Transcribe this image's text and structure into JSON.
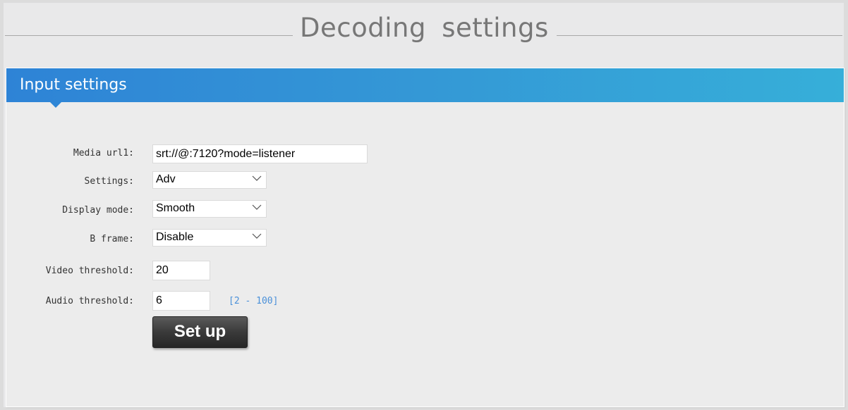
{
  "page": {
    "title": "Decoding  settings"
  },
  "panel": {
    "title": "Input settings",
    "header_gradient": [
      "#2e83d6",
      "#36afd9"
    ]
  },
  "form": {
    "media_url": {
      "label": "Media url1:",
      "value": "srt://@:7120?mode=listener"
    },
    "settings": {
      "label": "Settings:",
      "selected": "Adv"
    },
    "display_mode": {
      "label": "Display mode:",
      "selected": "Smooth"
    },
    "b_frame": {
      "label": "B frame:",
      "selected": "Disable"
    },
    "video_threshold": {
      "label": "Video threshold:",
      "value": "20"
    },
    "audio_threshold": {
      "label": "Audio threshold:",
      "value": "6",
      "range_hint": "[2 - 100]"
    },
    "submit_label": "Set up"
  },
  "colors": {
    "hint": "#4a90d9",
    "button": "#333333"
  }
}
